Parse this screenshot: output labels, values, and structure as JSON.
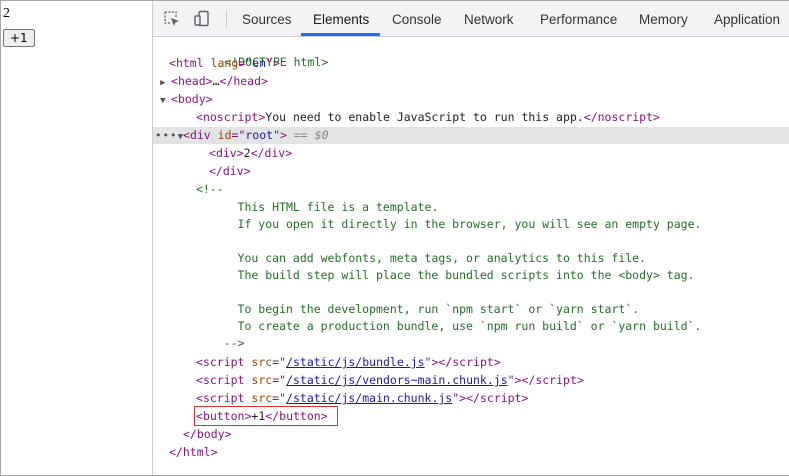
{
  "app": {
    "counter_value": "2",
    "button_label": "+1"
  },
  "devtools": {
    "tabs": [
      "Sources",
      "Elements",
      "Console",
      "Network",
      "Performance",
      "Memory",
      "Application"
    ],
    "active_tab": "Elements",
    "icons": [
      "inspect-element-icon",
      "device-toggle-icon"
    ],
    "accent_color": "#1a73e8",
    "highlight_color": "#d9322a",
    "dom": {
      "doctype": "<!DOCTYPE html>",
      "html_open": {
        "tag": "html",
        "attr_name": "lang",
        "attr_value": "en"
      },
      "head_collapsed": {
        "open": "head",
        "ellipsis": "…",
        "close": "head"
      },
      "body_open": "body",
      "noscript": {
        "tag": "noscript",
        "text": "You need to enable JavaScript to run this app."
      },
      "root_div": {
        "tag": "div",
        "attr_name": "id",
        "attr_value": "root",
        "console_ref": "== $0"
      },
      "inner_div": {
        "tag": "div",
        "text": "2"
      },
      "root_div_close": "div",
      "comment_lines": [
        "<!--",
        "      This HTML file is a template.",
        "      If you open it directly in the browser, you will see an empty page.",
        "",
        "      You can add webfonts, meta tags, or analytics to this file.",
        "      The build step will place the bundled scripts into the <body> tag.",
        "",
        "      To begin the development, run `npm start` or `yarn start`.",
        "      To create a production bundle, use `npm run build` or `yarn build`.",
        "    -->"
      ],
      "scripts": [
        {
          "tag": "script",
          "attr_name": "src",
          "src": "/static/js/bundle.js"
        },
        {
          "tag": "script",
          "attr_name": "src",
          "src": "/static/js/vendors~main.chunk.js"
        },
        {
          "tag": "script",
          "attr_name": "src",
          "src": "/static/js/main.chunk.js"
        }
      ],
      "button": {
        "tag": "button",
        "text": "+1"
      },
      "body_close": "body",
      "html_close": "html"
    }
  }
}
